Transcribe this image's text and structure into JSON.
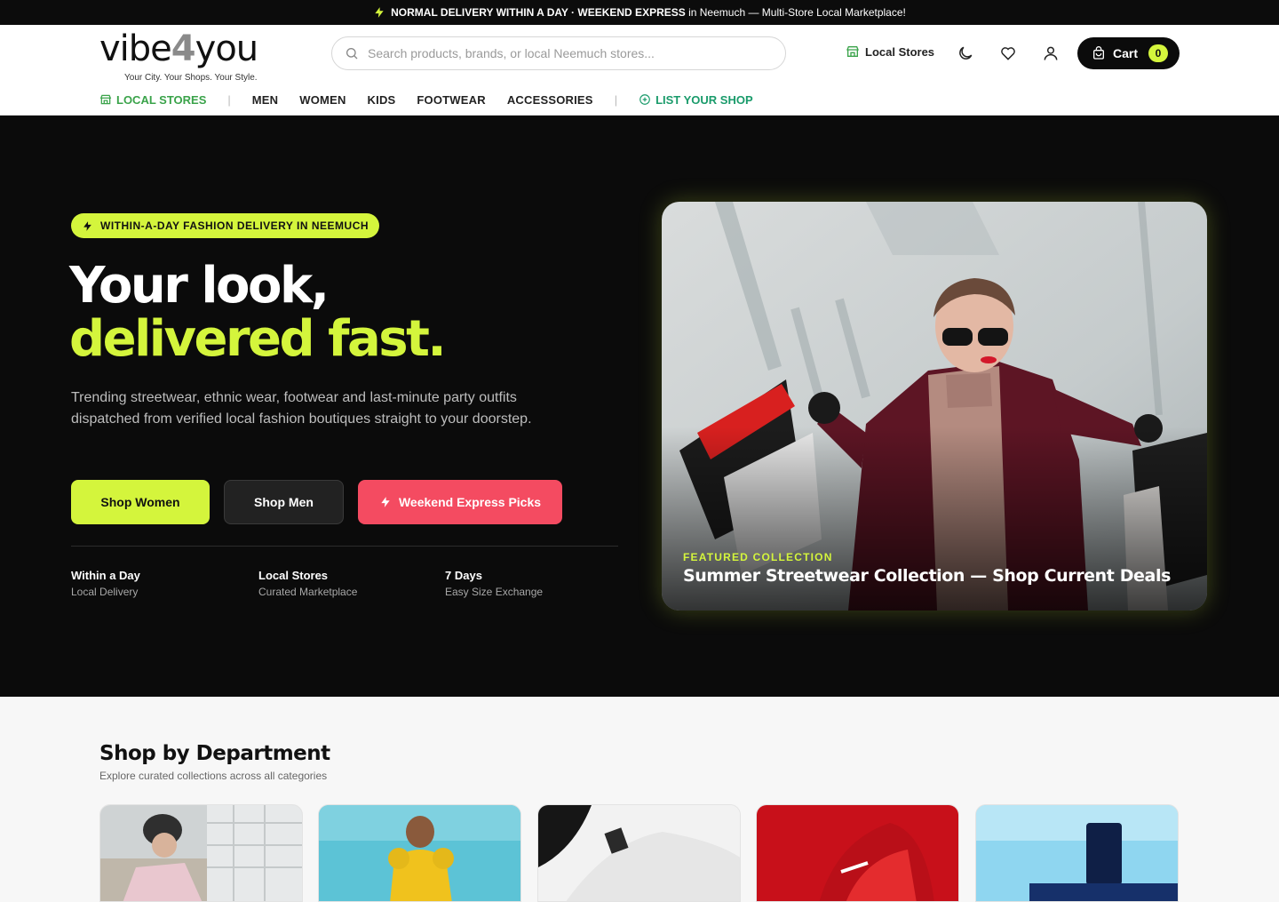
{
  "announcement": {
    "bold1": "NORMAL DELIVERY WITHIN A DAY",
    "dot": " · ",
    "bold2": "WEEKEND EXPRESS",
    "rest": " in Neemuch — Multi-Store Local Marketplace!"
  },
  "header": {
    "logo_left": "vibe",
    "logo_mid": "4",
    "logo_right": "you",
    "tagline": "Your City. Your Shops. Your Style.",
    "search_placeholder": "Search products, brands, or local Neemuch stores...",
    "local_stores": "Local Stores",
    "cart_label": "Cart",
    "cart_count": "0"
  },
  "nav": {
    "local_stores": "LOCAL STORES",
    "items": [
      "MEN",
      "WOMEN",
      "KIDS",
      "FOOTWEAR",
      "ACCESSORIES"
    ],
    "list_shop": "LIST YOUR SHOP",
    "separator": "|"
  },
  "hero": {
    "badge": "WITHIN-A-DAY FASHION DELIVERY IN NEEMUCH",
    "title_line1": "Your look,",
    "title_line2": "delivered fast.",
    "description": "Trending streetwear, ethnic wear, footwear and last-minute party outfits dispatched from verified local fashion boutiques straight to your doorstep.",
    "buttons": {
      "women": "Shop Women",
      "men": "Shop Men",
      "express": "Weekend Express Picks"
    },
    "stats": [
      {
        "title": "Within a Day",
        "subtitle": "Local Delivery"
      },
      {
        "title": "Local Stores",
        "subtitle": "Curated Marketplace"
      },
      {
        "title": "7 Days",
        "subtitle": "Easy Size Exchange"
      }
    ],
    "feature_label": "FEATURED COLLECTION",
    "feature_title": "Summer Streetwear Collection — Shop Current Deals"
  },
  "departments": {
    "title": "Shop by Department",
    "subtitle": "Explore curated collections across all categories"
  },
  "colors": {
    "accent": "#d4f53c",
    "express": "#f44b61",
    "dark": "#0b0b0b"
  },
  "icons": [
    "bolt-icon",
    "search-icon",
    "store-icon",
    "moon-icon",
    "heart-icon",
    "user-icon",
    "cart-icon",
    "plus-circle-icon"
  ]
}
